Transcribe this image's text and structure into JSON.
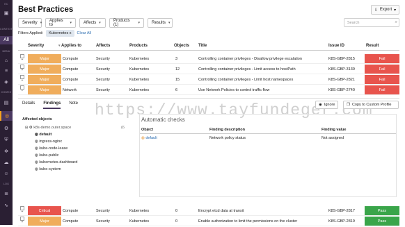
{
  "sidebar": {
    "tags": [
      "EC",
      "CONTEXT",
      "MENU",
      "CONFIG",
      "LOG"
    ],
    "all_label": "All",
    "icons": [
      "briefcase-icon",
      "home-icon",
      "layers-icon",
      "cube-icon",
      "chart-icon",
      "compass-icon",
      "plug-icon",
      "lock-icon",
      "gear-icon",
      "cloud-icon",
      "user-icon",
      "refresh-icon",
      "list-icon",
      "graph-icon"
    ]
  },
  "page": {
    "title": "Best Practices",
    "export_label": "Export"
  },
  "filters": {
    "severity": "Severity",
    "applies_to": "Applies to",
    "affects": "Affects",
    "products": "Products (1)",
    "results": "Results"
  },
  "search": {
    "placeholder": "Search"
  },
  "applied": {
    "label": "Filters Applied:",
    "chip": "Kubernetes x",
    "clear": "Clear All"
  },
  "columns": [
    "Severity",
    "Applies to",
    "Affects",
    "Products",
    "Objects",
    "Title",
    "Issue ID",
    "Result"
  ],
  "rows": [
    {
      "severity": "Major",
      "applies": "Compute",
      "affects": "Security",
      "product": "Kubernetes",
      "objects": "3",
      "title": "Controlling container privileges - Disallow privilege escalation",
      "issue": "K8S-GBP-2815",
      "result": "Fail",
      "exp": "+"
    },
    {
      "severity": "Major",
      "applies": "Compute",
      "affects": "Security",
      "product": "Kubernetes",
      "objects": "12",
      "title": "Controlling container privileges - Limit access to hostPath",
      "issue": "K8S-GBP-3139",
      "result": "Fail",
      "exp": "+"
    },
    {
      "severity": "Major",
      "applies": "Compute",
      "affects": "Security",
      "product": "Kubernetes",
      "objects": "15",
      "title": "Controlling container privileges - Limit host namespaces",
      "issue": "K8S-GBP-2821",
      "result": "Fail",
      "exp": "+"
    },
    {
      "severity": "Major",
      "applies": "Network",
      "affects": "Security",
      "product": "Kubernetes",
      "objects": "6",
      "title": "Use Network Policies to control traffic flow",
      "issue": "K8S-GBP-2740",
      "result": "Fail",
      "exp": "−"
    }
  ],
  "bottom_rows": [
    {
      "severity": "Critical",
      "applies": "Compute",
      "affects": "Security",
      "product": "Kubernetes",
      "objects": "0",
      "title": "Encrypt etcd data at transit",
      "issue": "K8S-GBP-2817",
      "result": "Pass",
      "exp": "+"
    },
    {
      "severity": "Major",
      "applies": "Compute",
      "affects": "Security",
      "product": "Kubernetes",
      "objects": "0",
      "title": "Enable authorization to limit the permissions on the cluster",
      "issue": "K8S-GBP-2819",
      "result": "Pass",
      "exp": "+"
    }
  ],
  "panel": {
    "tabs": [
      "Details",
      "Findings",
      "Note"
    ],
    "ignore": "Ignore",
    "copy": "Copy to Custom Profile",
    "affected_title": "Affected objects",
    "tree_root": "k8s-demo.outer.space",
    "tree_count": "(6",
    "tree_items": [
      "default",
      "ingress-nginx",
      "kube-node-lease",
      "kube-public",
      "kubernetes-dashboard",
      "kube-system"
    ],
    "auto_title": "Automatic checks",
    "auto_cols": [
      "Object",
      "Finding description",
      "Finding value"
    ],
    "auto_row": [
      "default",
      "Network policy status",
      "Not assigned"
    ]
  },
  "watermark": "https://www.tayfundeger.com",
  "colors": {
    "major": "#f0ad5c",
    "critical": "#e8544d",
    "fail": "#e8544d",
    "pass": "#3aa54a",
    "sidebar": "#2a1f33"
  }
}
